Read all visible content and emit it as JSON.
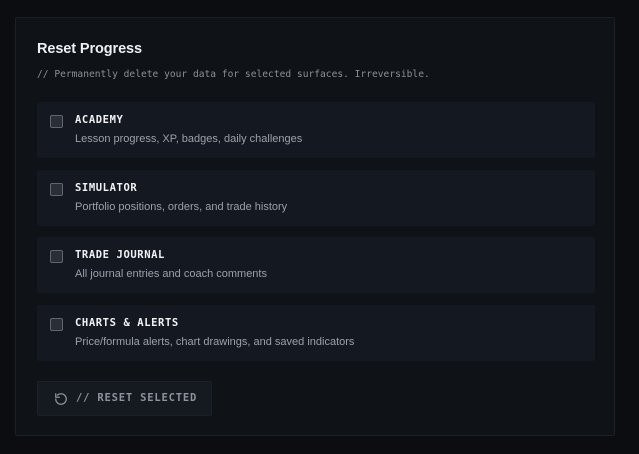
{
  "panel": {
    "title": "Reset Progress",
    "subtitle": "// Permanently delete your data for selected surfaces. Irreversible."
  },
  "surfaces": [
    {
      "label": "ACADEMY",
      "description": "Lesson progress, XP, badges, daily challenges",
      "checked": false
    },
    {
      "label": "SIMULATOR",
      "description": "Portfolio positions, orders, and trade history",
      "checked": false
    },
    {
      "label": "TRADE JOURNAL",
      "description": "All journal entries and coach comments",
      "checked": false
    },
    {
      "label": "CHARTS & ALERTS",
      "description": "Price/formula alerts, chart drawings, and saved indicators",
      "checked": false
    }
  ],
  "reset_button": {
    "label": "// RESET SELECTED",
    "icon": "rotate-ccw-icon"
  },
  "colors": {
    "background": "#0b0d11",
    "panel": "#0f1217",
    "row": "#141820",
    "text_primary": "#eef0f3",
    "text_muted": "#9aa1aa"
  }
}
